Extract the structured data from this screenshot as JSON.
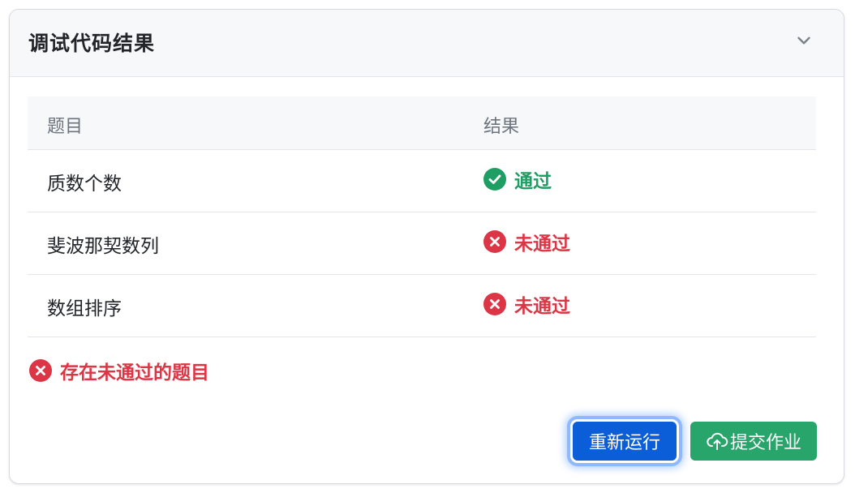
{
  "panel": {
    "title": "调试代码结果"
  },
  "table": {
    "headers": [
      "题目",
      "结果"
    ],
    "rows": [
      {
        "name": "质数个数",
        "result": "通过",
        "status": "pass"
      },
      {
        "name": "斐波那契数列",
        "result": "未通过",
        "status": "fail"
      },
      {
        "name": "数组排序",
        "result": "未通过",
        "status": "fail"
      }
    ]
  },
  "summary": {
    "text": "存在未通过的题目",
    "icon": "x-circle-icon"
  },
  "buttons": {
    "rerun_label": "重新运行",
    "submit_label": "提交作业",
    "submit_icon": "cloud-upload-icon"
  },
  "colors": {
    "pass": "#1e9e63",
    "fail": "#dc3545",
    "primary": "#0b5ed7",
    "success_button": "#27a56a"
  }
}
